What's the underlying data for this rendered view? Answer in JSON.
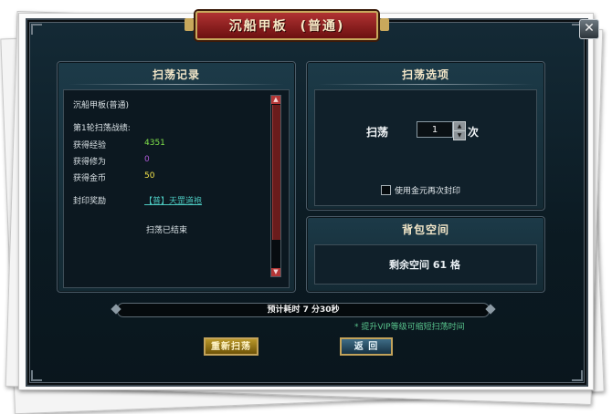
{
  "window": {
    "title": "沉船甲板",
    "title_mode": "(普通)",
    "close_label": "✕"
  },
  "record": {
    "heading": "扫荡记录",
    "dungeon_name": "沉船甲板(普通)",
    "round_label": "第1轮扫荡战绩:",
    "exp_label": "获得经验",
    "exp_value": "4351",
    "cultivation_label": "获得修为",
    "cultivation_value": "0",
    "gold_label": "获得金币",
    "gold_value": "50",
    "seal_label": "封印奖励",
    "seal_item": "【普】天罡道袍",
    "finished_text": "扫荡已结束"
  },
  "options": {
    "heading": "扫荡选项",
    "sweep_label": "扫荡",
    "count_value": "1",
    "times_label": "次",
    "use_gold_label": "使用金元再次封印",
    "use_gold_checked": false
  },
  "bag": {
    "heading": "背包空间",
    "remaining_text": "剩余空间 61 格"
  },
  "footer": {
    "time_text": "预计耗时 7 分30秒",
    "vip_tip": "* 提升VIP等级可缩短扫荡时间",
    "rescan_label": "重新扫荡",
    "back_label": "返 回"
  },
  "colors": {
    "exp": "#7fe04a",
    "cultivation": "#b05ad8",
    "gold": "#f2e24a",
    "seal_link": "#4cc9c0",
    "vip_tip": "#58c48c",
    "title_bg": "#8f1c1c"
  },
  "icons": {
    "close": "close-icon",
    "scroll_up": "triangle-up-icon",
    "scroll_down": "triangle-down-icon",
    "spin_up": "triangle-up-icon",
    "spin_down": "triangle-down-icon"
  }
}
